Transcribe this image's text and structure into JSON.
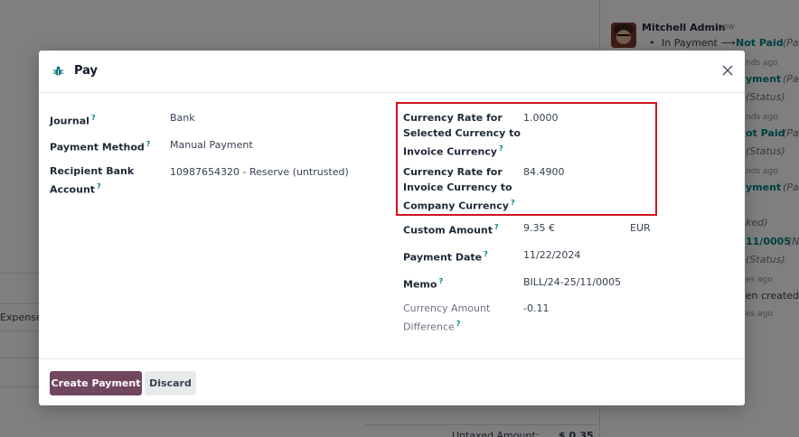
{
  "background": {
    "chatter": {
      "author": "Mitchell Admin",
      "time": "- now",
      "change_from": "In Payment",
      "change_arrow": "⟶",
      "change_to": "Not Paid",
      "change_field": "(Pa",
      "fragments": [
        {
          "text": "nds ago",
          "kind": "dim"
        },
        {
          "text": "yment",
          "kind": "link"
        },
        {
          "text": "(Pa",
          "kind": "it"
        },
        {
          "text": "(Status)",
          "kind": "it"
        },
        {
          "text": "nds ago",
          "kind": "dim"
        },
        {
          "text": "ot Paid",
          "kind": "link"
        },
        {
          "text": "(Pa",
          "kind": "it"
        },
        {
          "text": "(Status)",
          "kind": "it"
        },
        {
          "text": "nds ago",
          "kind": "dim"
        },
        {
          "text": "yment",
          "kind": "link"
        },
        {
          "text": "(Pa",
          "kind": "it"
        },
        {
          "text": "ked)",
          "kind": "it"
        },
        {
          "text": "11/0005",
          "kind": "link"
        },
        {
          "text": "(N",
          "kind": "it"
        },
        {
          "text": "(Status)",
          "kind": "it"
        },
        {
          "text": "es ago",
          "kind": "dim"
        },
        {
          "text": "een created",
          "kind": "plain"
        },
        {
          "text": "es ago",
          "kind": "dim"
        }
      ]
    },
    "left_text": "Expense",
    "bottom_label": "Untaxed Amount:",
    "bottom_value": "$ 0.35"
  },
  "modal": {
    "title": "Pay",
    "help_mark": "?",
    "left_fields": [
      {
        "label": "Journal",
        "value": "Bank"
      },
      {
        "label": "Payment Method",
        "value": "Manual Payment"
      },
      {
        "label_lines": [
          "Recipient Bank",
          "Account"
        ],
        "value": "10987654320 - Reserve (untrusted)"
      }
    ],
    "right_fields": {
      "rate_selected": {
        "label_lines": [
          "Currency Rate for",
          "Selected Currency to",
          "Invoice Currency"
        ],
        "value": "1.0000"
      },
      "rate_company": {
        "label_lines": [
          "Currency Rate for",
          "Invoice Currency to",
          "Company Currency"
        ],
        "value": "84.4900"
      },
      "custom_amount": {
        "label": "Custom Amount",
        "value": "9.35 €",
        "currency": "EUR"
      },
      "payment_date": {
        "label": "Payment Date",
        "value": "11/22/2024"
      },
      "memo": {
        "label": "Memo",
        "value": "BILL/24-25/11/0005"
      },
      "difference": {
        "label_lines": [
          "Currency Amount",
          "Difference"
        ],
        "value": "-0.11"
      }
    },
    "buttons": {
      "create": "Create Payment",
      "discard": "Discard"
    }
  },
  "colors": {
    "primary": "#71465f",
    "link": "#017e84",
    "highlight": "#d0121b"
  }
}
